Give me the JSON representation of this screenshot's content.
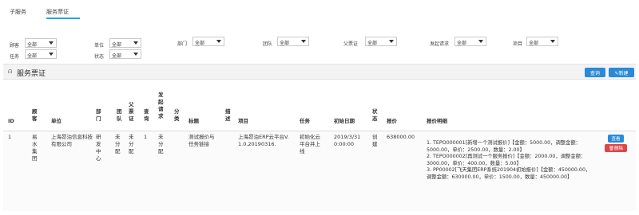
{
  "tabs": {
    "items": [
      "子服务",
      "服务票证"
    ],
    "active": "服务票证"
  },
  "filters": {
    "customer": {
      "label": "顾客",
      "value": "全部"
    },
    "task": {
      "label": "任务",
      "value": "全部"
    },
    "unit": {
      "label": "单位",
      "value": "全部"
    },
    "status": {
      "label": "状态",
      "value": "全部"
    },
    "dept": {
      "label": "部门",
      "value": "全部"
    },
    "team": {
      "label": "团队",
      "value": "全部"
    },
    "parent": {
      "label": "父票证",
      "value": "全部"
    },
    "request": {
      "label": "发起请求",
      "value": "全部"
    },
    "project": {
      "label": "项目",
      "value": "全部"
    }
  },
  "panel": {
    "icon": "ticket-icon",
    "title": "服务票证",
    "query_label": "查询",
    "new_label": "✎新建"
  },
  "table": {
    "headers": {
      "id": "ID",
      "customer": "顾客",
      "unit": "单位",
      "dept": "部门",
      "team": "团队",
      "parent": "父票证",
      "query": "查询",
      "request": "发起请求",
      "category": "分类",
      "title": "标题",
      "desc": "描述",
      "project": "项目",
      "task": "任务",
      "startdate": "初始日期",
      "status": "状态",
      "quote": "报价",
      "detail": "报价明细"
    },
    "row": {
      "id": "1",
      "customer": "易水集团",
      "unit": "上海昂泊信息科技有限公司",
      "dept": "研发中心",
      "team": "未分配",
      "parent": "未分配",
      "query": "1",
      "request": "未分配",
      "category": "",
      "title": "测试报价与任务链接",
      "desc": "",
      "project": "上海昂泊ERP云平台V.1.0.20190316.",
      "task": "初始化云平台并上线",
      "startdate": "2019/3/31 0:00:00",
      "status": "创建",
      "quote": "638000.00",
      "detail": "1. TEPO000001[新增一个测试报价]【金额：5000.00，调整金额：5000.00，单价：2500.00，数量：2.00】\n2. TEPO000002[再测试一个服务报价]【金额：2000.00，调整金额：3000.00，单价：400.00，数量：5.00】\n3. PP00002[飞天集团ERP系统201904初始报价]【金额：450000.00，调整金额：630000.00，单价：1500.00，数量：450000.00】",
      "view_label": "查看",
      "delete_label": "删除"
    }
  }
}
